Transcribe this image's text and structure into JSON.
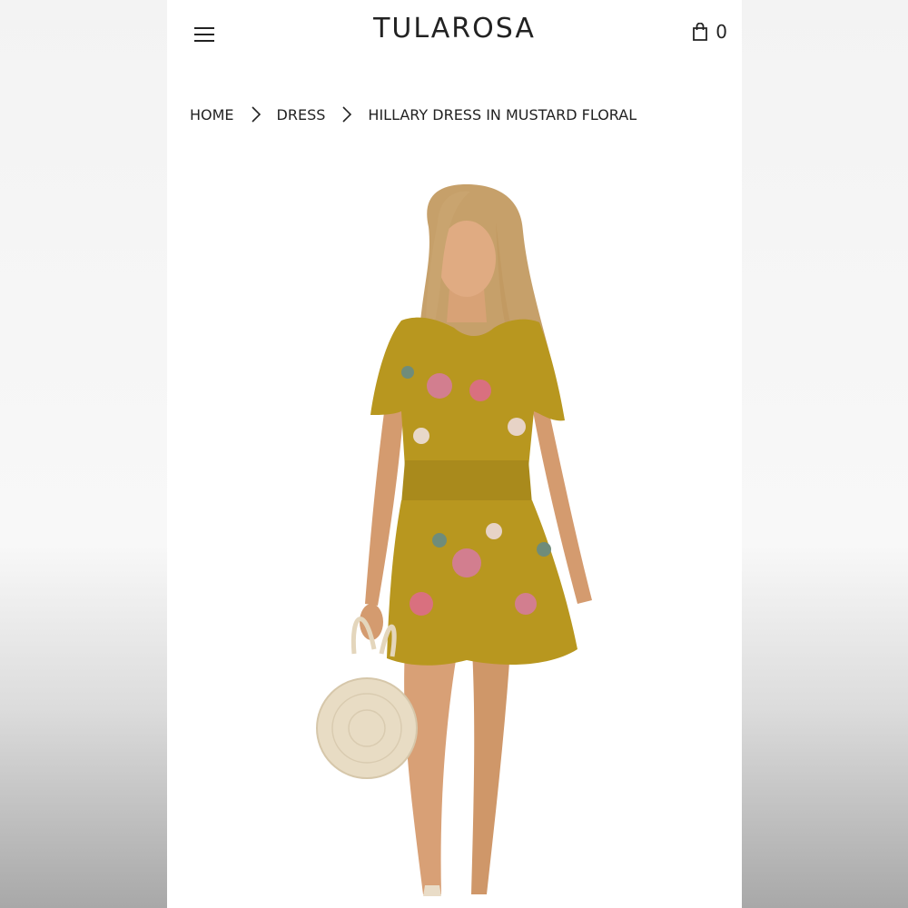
{
  "header": {
    "brand": "TULAROSA",
    "cart_count": "0"
  },
  "breadcrumb": {
    "items": [
      {
        "label": "HOME"
      },
      {
        "label": "DRESS"
      },
      {
        "label": "HILLARY DRESS IN MUSTARD FLORAL"
      }
    ]
  },
  "icons": {
    "menu": "hamburger-icon",
    "cart": "shopping-bag-icon",
    "separator": "chevron-right-icon"
  },
  "colors": {
    "dress": "#b8971f",
    "floral": "#d27e8f",
    "skin": "#d9a277",
    "hair": "#c6a06a",
    "bag": "#e8dcc4",
    "text": "#222222"
  }
}
